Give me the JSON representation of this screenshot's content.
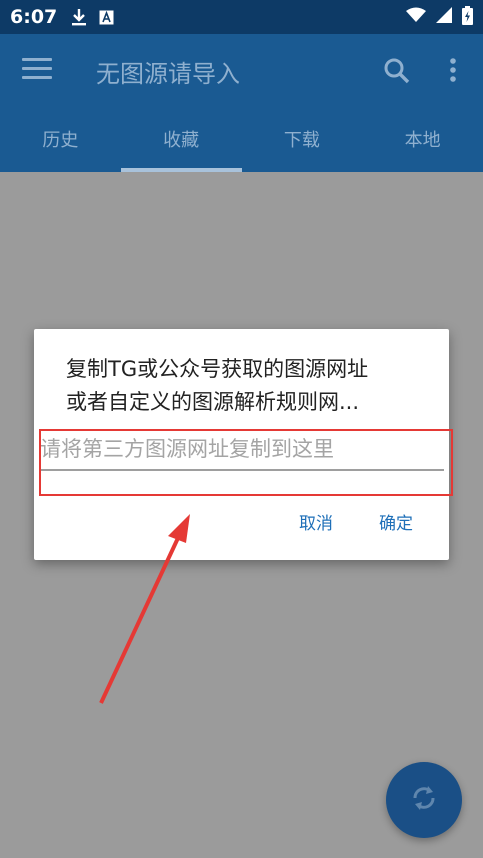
{
  "status_bar": {
    "time": "6:07",
    "icons": [
      "download-icon",
      "font-icon",
      "wifi-icon",
      "signal-icon",
      "battery-charging-icon"
    ]
  },
  "toolbar": {
    "title": "无图源请导入",
    "menu_icon": "hamburger-menu-icon",
    "search_icon": "search-icon",
    "more_icon": "more-vertical-icon"
  },
  "tabs": [
    {
      "label": "历史"
    },
    {
      "label": "收藏",
      "active": true
    },
    {
      "label": "下载"
    },
    {
      "label": "本地"
    }
  ],
  "dialog": {
    "message_line1": "复制TG或公众号获取的图源网址",
    "message_line2": "或者自定义的图源解析规则网...",
    "input_placeholder": "请将第三方图源网址复制到这里",
    "input_value": "",
    "cancel_label": "取消",
    "confirm_label": "确定"
  },
  "fab": {
    "icon": "sync-icon"
  },
  "colors": {
    "status_bar": "#0d3a66",
    "app_bar": "#1a5a92",
    "accent": "#1e6fb8",
    "highlight": "#e53935",
    "scrim": "#9b9b9b"
  }
}
